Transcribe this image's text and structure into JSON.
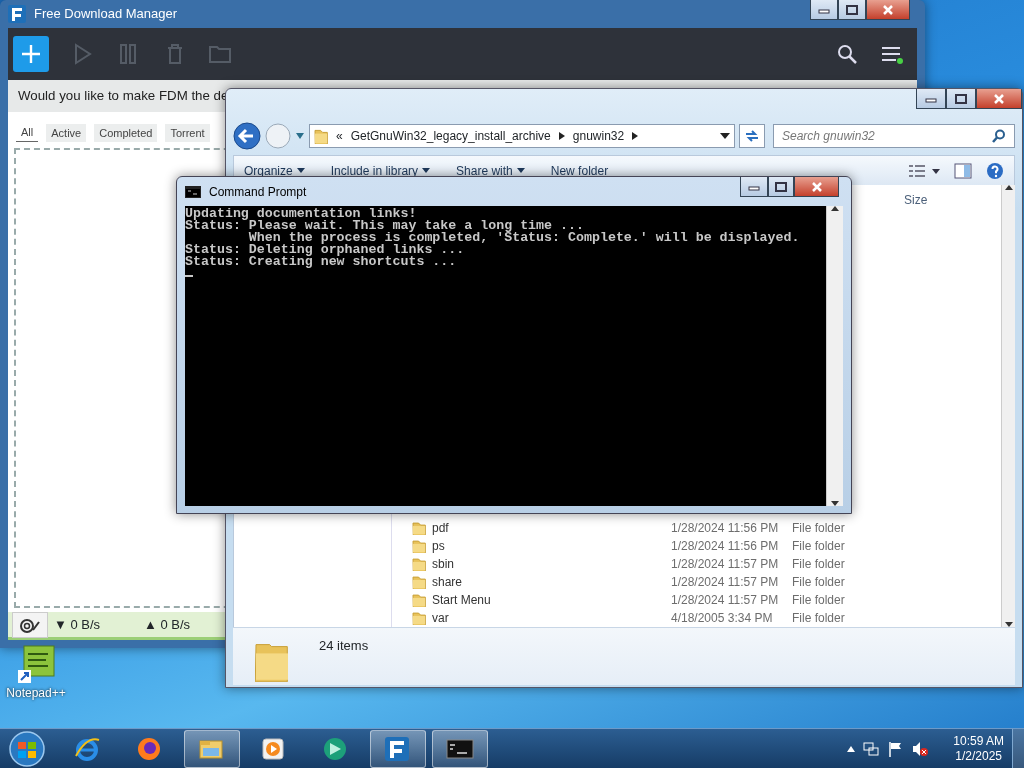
{
  "fdm": {
    "title": "Free Download Manager",
    "banner": "Would you like to make FDM the de",
    "tabs": [
      {
        "label": "All",
        "selected": true
      },
      {
        "label": "Active",
        "selected": false
      },
      {
        "label": "Completed",
        "selected": false
      },
      {
        "label": "Torrent",
        "selected": false
      }
    ],
    "download_speed": "▼ 0 B/s",
    "upload_speed": "▲ 0 B/s"
  },
  "explorer": {
    "breadcrumb": [
      "«",
      "GetGnuWin32_legacy_install_archive",
      "gnuwin32"
    ],
    "search_placeholder": "Search gnuwin32",
    "toolbar": [
      {
        "label": "Organize",
        "dropdown": true
      },
      {
        "label": "Include in library",
        "dropdown": true
      },
      {
        "label": "Share with",
        "dropdown": true
      },
      {
        "label": "New folder",
        "dropdown": false
      }
    ],
    "columns": [
      "Size"
    ],
    "rows": [
      {
        "name": "pdf",
        "date": "1/28/2024 11:56 PM",
        "type": "File folder"
      },
      {
        "name": "ps",
        "date": "1/28/2024 11:56 PM",
        "type": "File folder"
      },
      {
        "name": "sbin",
        "date": "1/28/2024 11:57 PM",
        "type": "File folder"
      },
      {
        "name": "share",
        "date": "1/28/2024 11:57 PM",
        "type": "File folder"
      },
      {
        "name": "Start Menu",
        "date": "1/28/2024 11:57 PM",
        "type": "File folder"
      },
      {
        "name": "var",
        "date": "4/18/2005 3:34 PM",
        "type": "File folder"
      }
    ],
    "status": "24 items"
  },
  "console": {
    "title": "Command Prompt",
    "lines": [
      "Updating documentation links!",
      "Status: Please wait. This may take a long time ...",
      "        When the process is completed, 'Status: Complete.' will be displayed.",
      "Status: Deleting orphaned links ...",
      "Status: Creating new shortcuts ..."
    ]
  },
  "desktop_icons": [
    {
      "label": "Notepad++"
    }
  ],
  "taskbar": {
    "apps": [
      {
        "kind": "ie",
        "open": false
      },
      {
        "kind": "firefox",
        "open": false
      },
      {
        "kind": "explorer",
        "open": true
      },
      {
        "kind": "media",
        "open": false
      },
      {
        "kind": "green",
        "open": false
      },
      {
        "kind": "fdm",
        "open": true
      },
      {
        "kind": "console",
        "open": true
      }
    ],
    "time": "10:59 AM",
    "date": "1/2/2025"
  }
}
